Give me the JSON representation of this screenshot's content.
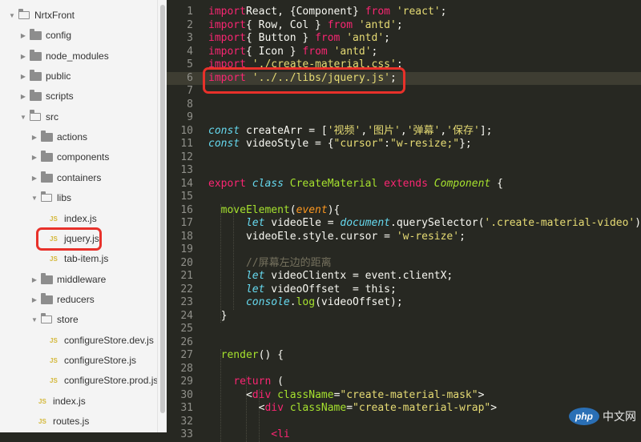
{
  "sidebar": {
    "items": [
      {
        "label": "NrtxFront",
        "type": "folder",
        "open": true,
        "depth": 0
      },
      {
        "label": "config",
        "type": "folder",
        "open": false,
        "depth": 1
      },
      {
        "label": "node_modules",
        "type": "folder",
        "open": false,
        "depth": 1
      },
      {
        "label": "public",
        "type": "folder",
        "open": false,
        "depth": 1
      },
      {
        "label": "scripts",
        "type": "folder",
        "open": false,
        "depth": 1
      },
      {
        "label": "src",
        "type": "folder",
        "open": true,
        "depth": 1
      },
      {
        "label": "actions",
        "type": "folder",
        "open": false,
        "depth": 2
      },
      {
        "label": "components",
        "type": "folder",
        "open": false,
        "depth": 2
      },
      {
        "label": "containers",
        "type": "folder",
        "open": false,
        "depth": 2
      },
      {
        "label": "libs",
        "type": "folder",
        "open": true,
        "depth": 2
      },
      {
        "label": "index.js",
        "type": "file",
        "depth": 3
      },
      {
        "label": "jquery.js",
        "type": "file",
        "depth": 3,
        "selected": true
      },
      {
        "label": "tab-item.js",
        "type": "file",
        "depth": 3
      },
      {
        "label": "middleware",
        "type": "folder",
        "open": false,
        "depth": 2
      },
      {
        "label": "reducers",
        "type": "folder",
        "open": false,
        "depth": 2
      },
      {
        "label": "store",
        "type": "folder",
        "open": true,
        "depth": 2
      },
      {
        "label": "configureStore.dev.js",
        "type": "file",
        "depth": 3
      },
      {
        "label": "configureStore.js",
        "type": "file",
        "depth": 3
      },
      {
        "label": "configureStore.prod.js",
        "type": "file",
        "depth": 3
      },
      {
        "label": "index.js",
        "type": "file",
        "depth": 2
      },
      {
        "label": "routes.js",
        "type": "file",
        "depth": 2
      }
    ],
    "file_badge": "JS"
  },
  "editor": {
    "current_line": 6,
    "lines": [
      [
        [
          "k",
          "import"
        ],
        [
          "",
          "React, {Component} "
        ],
        [
          "k",
          "from"
        ],
        [
          "",
          " "
        ],
        [
          "s",
          "'react'"
        ],
        [
          "",
          ";"
        ]
      ],
      [
        [
          "k",
          "import"
        ],
        [
          "",
          "{ Row, Col } "
        ],
        [
          "k",
          "from"
        ],
        [
          "",
          " "
        ],
        [
          "s",
          "'antd'"
        ],
        [
          "",
          ";"
        ]
      ],
      [
        [
          "k",
          "import"
        ],
        [
          "",
          "{ Button } "
        ],
        [
          "k",
          "from"
        ],
        [
          "",
          " "
        ],
        [
          "s",
          "'antd'"
        ],
        [
          "",
          ";"
        ]
      ],
      [
        [
          "k",
          "import"
        ],
        [
          "",
          "{ Icon } "
        ],
        [
          "k",
          "from"
        ],
        [
          "",
          " "
        ],
        [
          "s",
          "'antd'"
        ],
        [
          "",
          ";"
        ]
      ],
      [
        [
          "k",
          "import"
        ],
        [
          "",
          " "
        ],
        [
          "s",
          "'./create-material.css'"
        ],
        [
          "",
          ";"
        ]
      ],
      [
        [
          "k",
          "import"
        ],
        [
          "",
          " "
        ],
        [
          "s",
          "'../../libs/jquery.js'"
        ],
        [
          "",
          ";"
        ]
      ],
      [],
      [],
      [],
      [
        [
          "it",
          "const"
        ],
        [
          "",
          " createArr = ["
        ],
        [
          "s",
          "'视频'"
        ],
        [
          "",
          ","
        ],
        [
          "s",
          "'图片'"
        ],
        [
          "",
          ","
        ],
        [
          "s",
          "'弹幕'"
        ],
        [
          "",
          ","
        ],
        [
          "s",
          "'保存'"
        ],
        [
          "",
          "];"
        ]
      ],
      [
        [
          "it",
          "const"
        ],
        [
          "",
          " videoStyle = {"
        ],
        [
          "s",
          "\"cursor\""
        ],
        [
          "",
          ":"
        ],
        [
          "s",
          "\"w-resize;\""
        ],
        [
          "",
          "};"
        ]
      ],
      [],
      [],
      [
        [
          "k",
          "export"
        ],
        [
          "",
          " "
        ],
        [
          "it",
          "class"
        ],
        [
          "",
          " "
        ],
        [
          "cl",
          "CreateMaterial"
        ],
        [
          "",
          " "
        ],
        [
          "k",
          "extends"
        ],
        [
          "",
          " "
        ],
        [
          "cli",
          "Component"
        ],
        [
          "",
          " {"
        ]
      ],
      [],
      [
        [
          "",
          "  "
        ],
        [
          "cl",
          "moveElement"
        ],
        [
          "",
          "("
        ],
        [
          "pm",
          "event"
        ],
        [
          "",
          "){"
        ]
      ],
      [
        [
          "",
          "      "
        ],
        [
          "it",
          "let"
        ],
        [
          "",
          " videoEle = "
        ],
        [
          "it",
          "document"
        ],
        [
          "",
          ".querySelector("
        ],
        [
          "s",
          "'.create-material-video'"
        ],
        [
          "",
          ");"
        ]
      ],
      [
        [
          "",
          "      videoEle.style.cursor = "
        ],
        [
          "s",
          "'w-resize'"
        ],
        [
          "",
          ";"
        ]
      ],
      [],
      [
        [
          "",
          "      "
        ],
        [
          "cm",
          "//屏幕左边的距离"
        ]
      ],
      [
        [
          "",
          "      "
        ],
        [
          "it",
          "let"
        ],
        [
          "",
          " videoClientx = event.clientX;"
        ]
      ],
      [
        [
          "",
          "      "
        ],
        [
          "it",
          "let"
        ],
        [
          "",
          " videoOffset  = this;"
        ]
      ],
      [
        [
          "",
          "      "
        ],
        [
          "it",
          "console"
        ],
        [
          "",
          "."
        ],
        [
          "cl",
          "log"
        ],
        [
          "",
          "(videoOffset);"
        ]
      ],
      [
        [
          "",
          "  }"
        ]
      ],
      [],
      [],
      [
        [
          "",
          "  "
        ],
        [
          "cl",
          "render"
        ],
        [
          "",
          "() {"
        ]
      ],
      [],
      [
        [
          "",
          "    "
        ],
        [
          "k",
          "return"
        ],
        [
          "",
          " ("
        ]
      ],
      [
        [
          "",
          "      <"
        ],
        [
          "k",
          "div"
        ],
        [
          "",
          " "
        ],
        [
          "cl",
          "className"
        ],
        [
          "",
          "="
        ],
        [
          "s",
          "\"create-material-mask\""
        ],
        [
          "",
          ">"
        ]
      ],
      [
        [
          "",
          "        <"
        ],
        [
          "k",
          "div"
        ],
        [
          "",
          " "
        ],
        [
          "cl",
          "className"
        ],
        [
          "",
          "="
        ],
        [
          "s",
          "\"create-material-wrap\""
        ],
        [
          "",
          ">"
        ]
      ],
      [],
      [
        [
          "",
          "          "
        ],
        [
          "k",
          "<li"
        ]
      ]
    ]
  },
  "watermark": {
    "logo_text": "php",
    "site_text": "中文网"
  }
}
